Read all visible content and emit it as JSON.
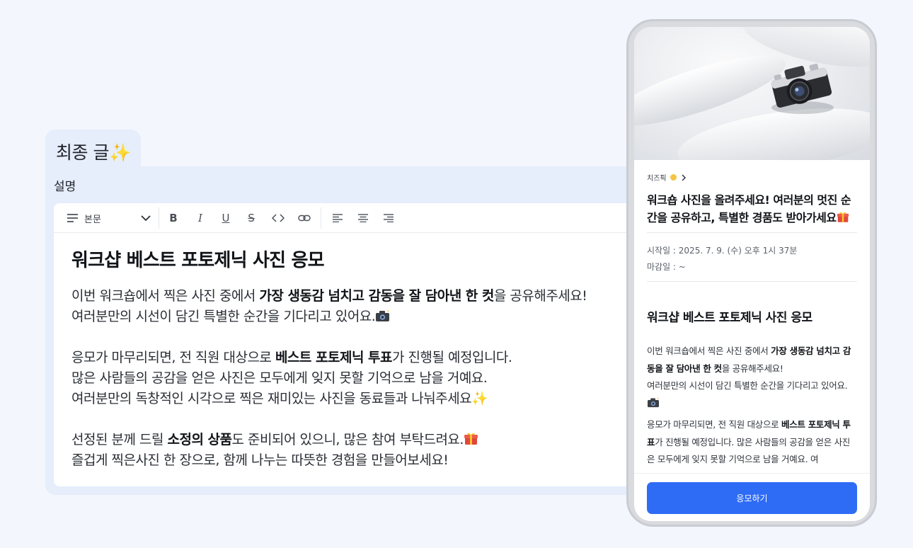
{
  "editor": {
    "tab_title": "최종 글",
    "tab_emoji": "✨",
    "description_label": "설명",
    "toolbar": {
      "text_style": "본문",
      "buttons": [
        "bold",
        "italic",
        "underline",
        "strikethrough",
        "code",
        "link",
        "align-left",
        "align-center",
        "align-right"
      ],
      "bold_label": "B",
      "italic_label": "I",
      "underline_label": "U",
      "strike_label": "S"
    },
    "content": {
      "heading": "워크샵 베스트 포토제닉 사진 응모",
      "p1_a": "이번 워크숍에서 찍은 사진 중에서 ",
      "p1_bold": "가장 생동감 넘치고 감동을 잘 담아낸 한 컷",
      "p1_b": "을 공유해주세요!",
      "p1_c": "여러분만의 시선이 담긴 특별한 순간을 기다리고 있어요.",
      "p2_a": "응모가 마무리되면, 전 직원 대상으로 ",
      "p2_bold": "베스트 포토제닉 투표",
      "p2_b": "가 진행될 예정입니다.",
      "p2_c": "많은 사람들의 공감을 얻은 사진은 모두에게 잊지 못할 기억으로 남을 거예요.",
      "p2_d": "여러분만의 독창적인 시각으로 찍은 재미있는 사진을 동료들과 나눠주세요",
      "p3_a": "선정된 분께 드릴 ",
      "p3_bold": "소정의 상품",
      "p3_b": "도 준비되어 있으니, 많은 참여 부탁드려요.",
      "p3_c": "즐겁게 찍은사진 한 장으로, 함께 나누는 따뜻한 경험을 만들어보세요!"
    }
  },
  "preview": {
    "category": "치즈픽",
    "title": "워크숍 사진을 올려주세요! 여러분의 멋진 순간을 공유하고, 특별한 경품도 받아가세요",
    "start_date": "시작일 : 2025. 7. 9. (수) 오후 1시 37분",
    "end_date": "마감일 : ~",
    "heading": "워크샵 베스트 포토제닉 사진 응모",
    "body_p1_a": "이번 워크숍에서 찍은 사진 중에서 ",
    "body_p1_bold": "가장 생동감 넘치고 감동을 잘 담아낸 한 컷",
    "body_p1_b": "을 공유해주세요!",
    "body_p1_c": "여러분만의 시선이 담긴 특별한 순간을 기다리고 있어요.",
    "body_p2_a": "응모가 마무리되면, 전 직원 대상으로 ",
    "body_p2_bold": "베스트 포토제닉 투표",
    "body_p2_b": "가 진행될 예정입니다. 많은 사람들의 공감을 얻은 사진은 모두에게 잊지 못할 기억으로 남을 거예요. 여",
    "apply_button": "응모하기"
  },
  "colors": {
    "accent": "#2f6cf6",
    "card_bg": "#e6edfb",
    "page_bg": "#f3f6fd"
  }
}
